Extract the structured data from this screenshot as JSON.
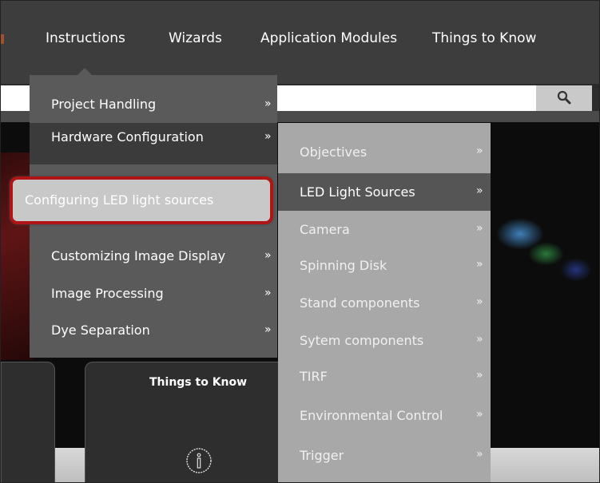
{
  "nav": {
    "items": [
      "Instructions",
      "Wizards",
      "Application Modules",
      "Things to Know"
    ]
  },
  "search": {
    "placeholder": "",
    "icon": "search-icon"
  },
  "menu1": {
    "items": [
      {
        "label": "Project Handling",
        "chevron": "»"
      },
      {
        "label": "Hardware Configuration",
        "chevron": "»"
      },
      {
        "label": "Customizing Image Display",
        "chevron": "»"
      },
      {
        "label": "Image Processing",
        "chevron": "»"
      },
      {
        "label": "Dye Separation",
        "chevron": "»"
      }
    ],
    "active_index": 1
  },
  "highlight": {
    "label": "Configuring LED light sources",
    "border_color": "#b01414"
  },
  "menu2": {
    "items": [
      {
        "label": "Objectives",
        "chevron": "»"
      },
      {
        "label": "LED Light Sources",
        "chevron": "»"
      },
      {
        "label": "Camera",
        "chevron": "»"
      },
      {
        "label": "Spinning Disk",
        "chevron": "»"
      },
      {
        "label": "Stand components",
        "chevron": "»"
      },
      {
        "label": "Sytem components",
        "chevron": "»"
      },
      {
        "label": "TIRF",
        "chevron": "»"
      },
      {
        "label": "Environmental Control",
        "chevron": "»"
      },
      {
        "label": "Trigger",
        "chevron": "»"
      }
    ],
    "active_index": 1
  },
  "card": {
    "title": "Things to Know",
    "icon": "info-icon"
  },
  "colors": {
    "nav_bg": "#3d3d3d",
    "menu1_bg": "#5a5a5a",
    "menu2_bg": "#a8a8a8",
    "highlight_border": "#b01414"
  }
}
